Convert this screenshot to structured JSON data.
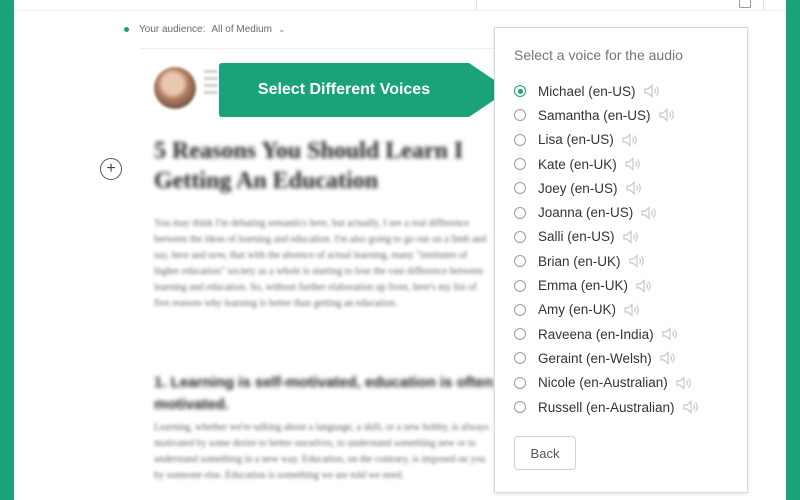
{
  "page": {
    "accent_color": "#1aa37a"
  },
  "audience": {
    "label": "Your audience:",
    "value": "All of Medium"
  },
  "article": {
    "title_line1": "5 Reasons You Should Learn I",
    "title_line2": "Getting An Education",
    "paragraph1": "You may think I'm debating semantics here, but actually, I see a real difference between the ideas of learning and education. I'm also going to go out on a limb and say, here and now, that with the absence of actual learning, many \"institutes of higher education\" society as a whole is starting to lose the vast difference between learning and education. So, without further elaboration up front, here's my list of five reasons why learning is better than getting an education.",
    "subhead": "1. Learning is self-motivated, education is often motivated.",
    "paragraph2": "Learning, whether we're talking about a language, a skill, or a new hobby, is always motivated by some desire to better ourselves, to understand something new or to understand something in a new way. Education, on the contrary, is imposed on you by someone else. Education is something we are told we need."
  },
  "callout": {
    "text": "Select Different Voices"
  },
  "panel": {
    "heading": "Select a voice for the audio",
    "back_label": "Back",
    "voices": [
      {
        "label": "Michael (en-US)",
        "selected": true
      },
      {
        "label": "Samantha (en-US)",
        "selected": false
      },
      {
        "label": "Lisa (en-US)",
        "selected": false
      },
      {
        "label": "Kate (en-UK)",
        "selected": false
      },
      {
        "label": "Joey (en-US)",
        "selected": false
      },
      {
        "label": "Joanna (en-US)",
        "selected": false
      },
      {
        "label": "Salli (en-US)",
        "selected": false
      },
      {
        "label": "Brian (en-UK)",
        "selected": false
      },
      {
        "label": "Emma (en-UK)",
        "selected": false
      },
      {
        "label": "Amy (en-UK)",
        "selected": false
      },
      {
        "label": "Raveena (en-India)",
        "selected": false
      },
      {
        "label": "Geraint (en-Welsh)",
        "selected": false
      },
      {
        "label": "Nicole (en-Australian)",
        "selected": false
      },
      {
        "label": "Russell (en-Australian)",
        "selected": false
      }
    ]
  },
  "icons": {
    "speaker": "speaker-icon",
    "add": "add-icon",
    "chevron": "chevron-down-icon"
  }
}
